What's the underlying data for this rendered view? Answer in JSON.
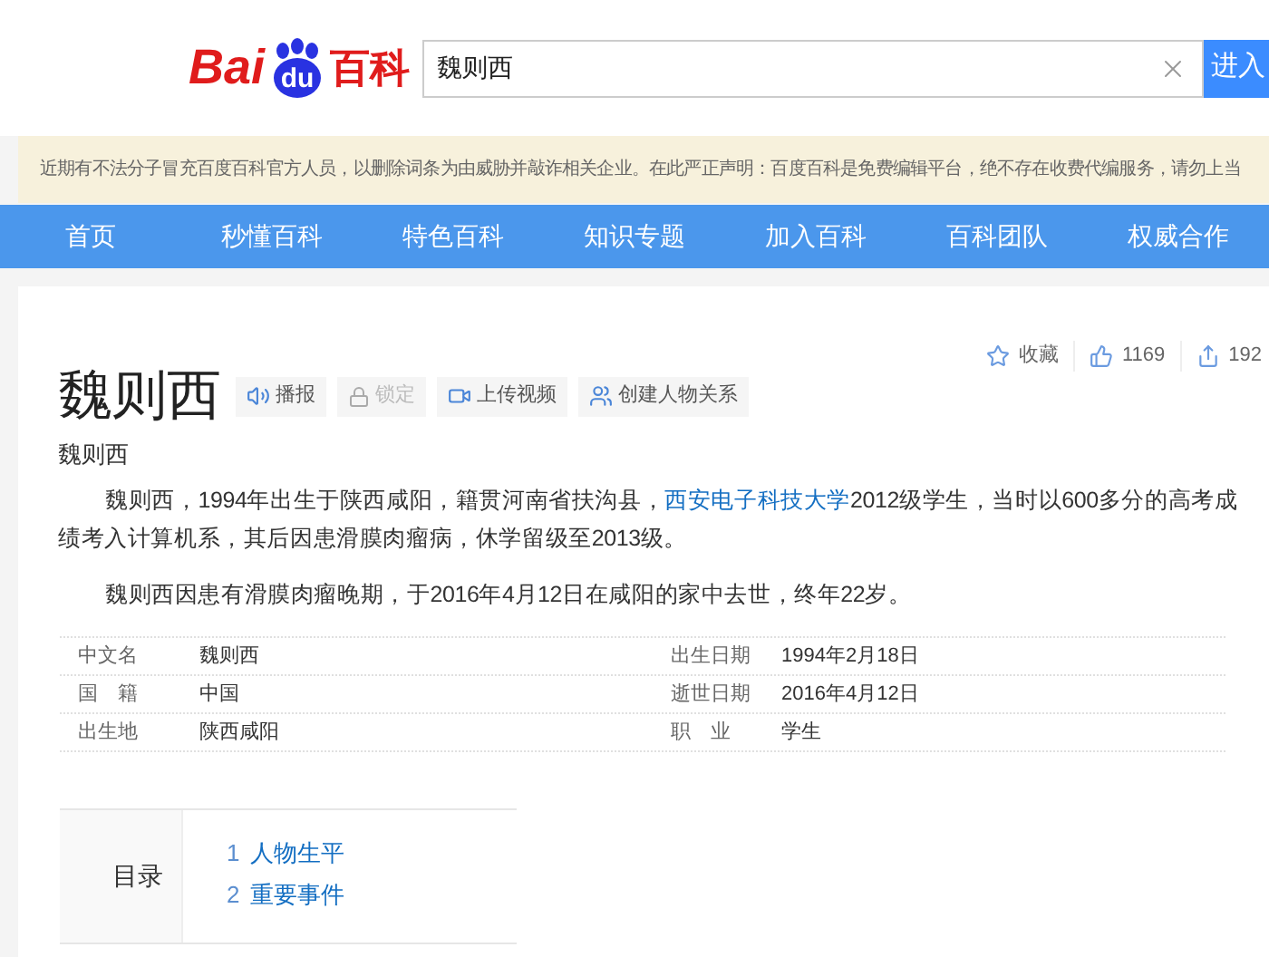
{
  "logo": {
    "left": "Bai",
    "badge": "du",
    "right": "百科"
  },
  "search": {
    "value": "魏则西",
    "button": "进入"
  },
  "notice": "近期有不法分子冒充百度百科官方人员，以删除词条为由威胁并敲诈相关企业。在此严正声明：百度百科是免费编辑平台，绝不存在收费代编服务，请勿上当",
  "nav": [
    "首页",
    "秒懂百科",
    "特色百科",
    "知识专题",
    "加入百科",
    "百科团队",
    "权威合作"
  ],
  "stats": [
    {
      "kind": "star",
      "label": "收藏"
    },
    {
      "kind": "like",
      "label": "1169"
    },
    {
      "kind": "share",
      "label": "192"
    }
  ],
  "title": "魏则西",
  "actions": [
    {
      "kind": "sound",
      "label": "播报",
      "disabled": false
    },
    {
      "kind": "lock",
      "label": "锁定",
      "disabled": true
    },
    {
      "kind": "video",
      "label": "上传视频",
      "disabled": false
    },
    {
      "kind": "people",
      "label": "创建人物关系",
      "disabled": false
    }
  ],
  "subtitle": "魏则西",
  "paragraphs": [
    {
      "before": "魏则西，1994年出生于陕西咸阳，籍贯河南省扶沟县，",
      "link": "西安电子科技大学",
      "after": "2012级学生，当时以600多分的高考成绩考入计算机系，其后因患滑膜肉瘤病，休学留级至2013级。"
    },
    {
      "before": "魏则西因患有滑膜肉瘤晚期，于2016年4月12日在咸阳的家中去世，终年22岁。"
    }
  ],
  "info": [
    {
      "label": "中文名",
      "value": "魏则西",
      "label2": "出生日期",
      "value2": "1994年2月18日"
    },
    {
      "label": "国　籍",
      "value": "中国",
      "label2": "逝世日期",
      "value2": "2016年4月12日"
    },
    {
      "label": "出生地",
      "value": "陕西咸阳",
      "label2": "职　业",
      "value2": "学生"
    }
  ],
  "toc": {
    "title": "目录",
    "items": [
      {
        "number": "1",
        "label": "人物生平"
      },
      {
        "number": "2",
        "label": "重要事件"
      }
    ]
  }
}
